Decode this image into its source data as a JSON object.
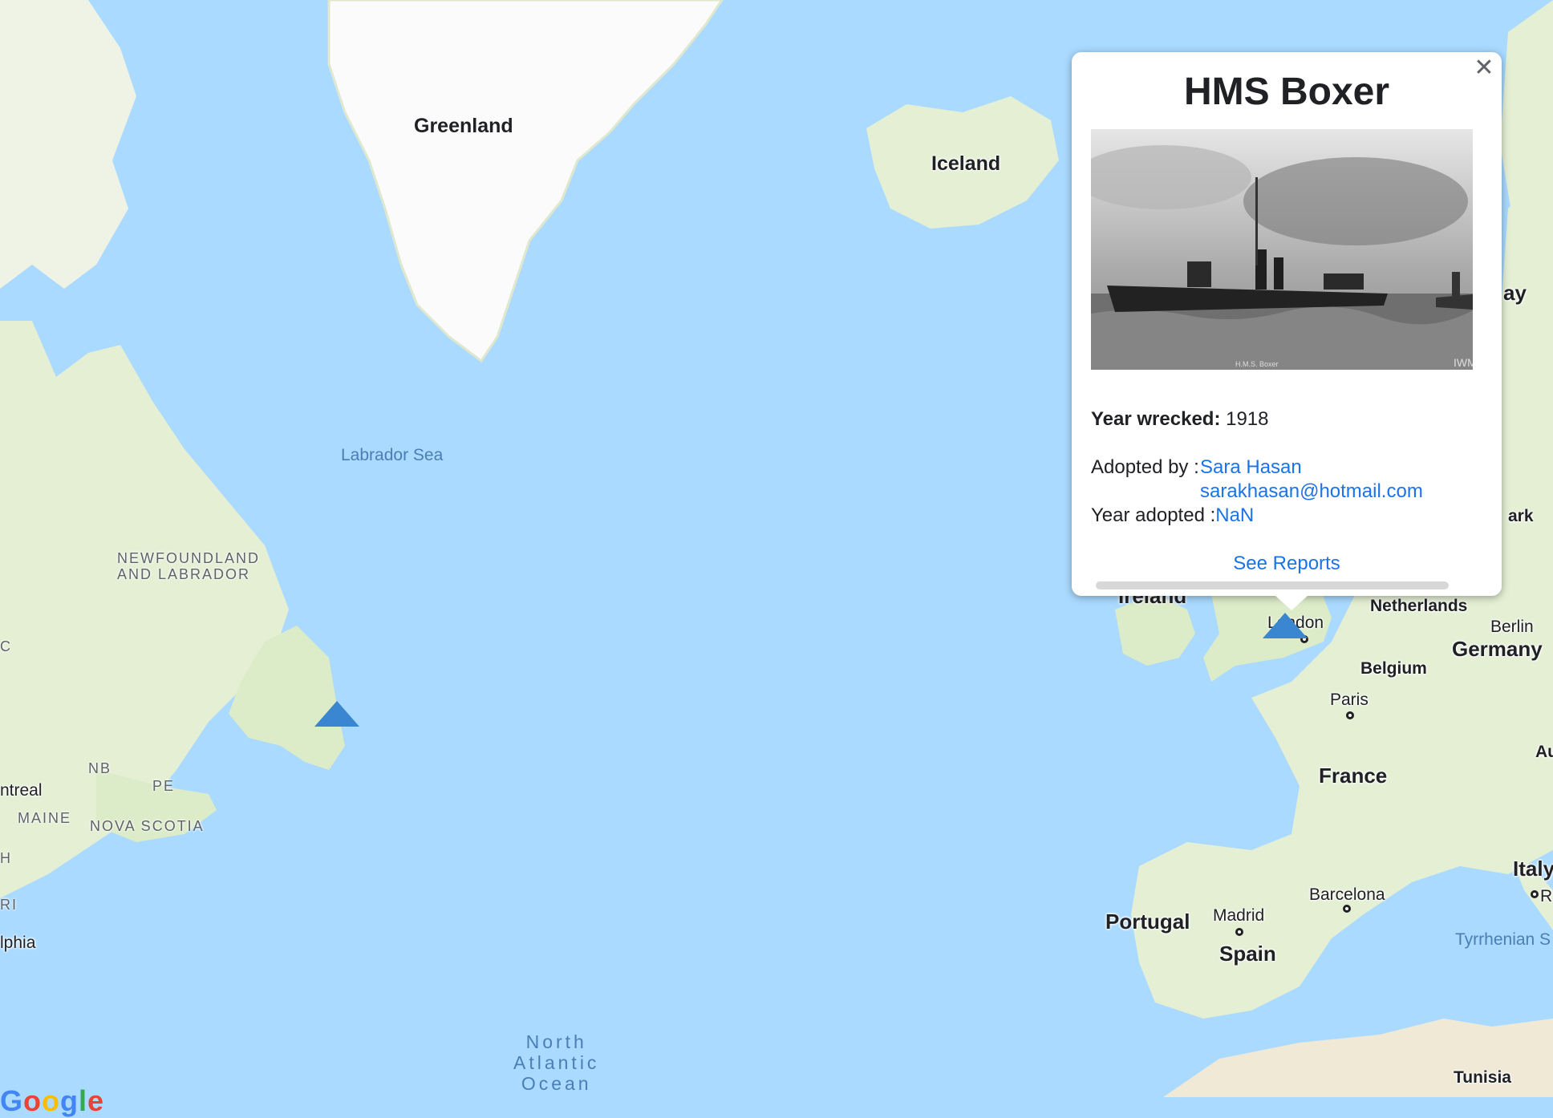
{
  "map": {
    "countries": {
      "greenland": "Greenland",
      "iceland": "Iceland",
      "ireland": "Ireland",
      "netherlands": "Netherlands",
      "germany": "Germany",
      "belgium": "Belgium",
      "france": "France",
      "portugal": "Portugal",
      "spain": "Spain",
      "italy": "Italy",
      "tunisia": "Tunisia",
      "norway_partial": "ay",
      "denmark_partial": "ark",
      "austria_partial": "Au"
    },
    "cities": {
      "london": "London",
      "paris": "Paris",
      "madrid": "Madrid",
      "barcelona": "Barcelona",
      "berlin": "Berlin",
      "montreal_partial": "ntreal",
      "philadelphia_partial": "lphia",
      "rome_partial": "R"
    },
    "regions": {
      "newfoundland": "NEWFOUNDLAND\nAND LABRADOR",
      "nb": "NB",
      "pe": "PE",
      "maine": "MAINE",
      "nova_scotia": "NOVA SCOTIA",
      "nh_partial": "H",
      "ri_partial": "RI",
      "qc_partial": "C"
    },
    "waters": {
      "labrador_sea": "Labrador Sea",
      "north_atlantic": "North\nAtlantic\nOcean",
      "tyrrhenian": "Tyrrhenian S"
    },
    "attribution": "Google",
    "colors": {
      "water": "#aadaff",
      "land": "#e4efd4",
      "ice": "#fbfbfb",
      "marker": "#3a86d0"
    }
  },
  "markers": [
    {
      "name": "wreck-marker-newfoundland"
    },
    {
      "name": "wreck-marker-hms-boxer"
    }
  ],
  "popup": {
    "title": "HMS Boxer",
    "photo_caption": "H.M.S. Boxer",
    "photo_watermark": "IWM",
    "year_wrecked_label": "Year wrecked:",
    "year_wrecked": "1918",
    "adopted_by_label": "Adopted by :",
    "adopter_name": "Sara Hasan",
    "adopter_email": "sarakhasan@hotmail.com",
    "year_adopted_label": "Year adopted :",
    "year_adopted": "NaN",
    "see_reports": "See Reports",
    "close_icon": "close-icon"
  }
}
